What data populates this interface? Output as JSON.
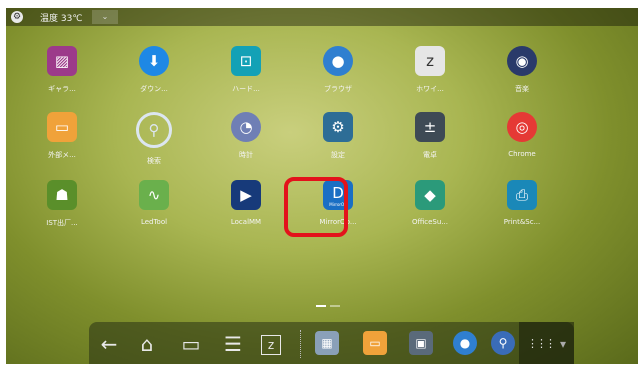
{
  "status_bar": {
    "temperature": "温度 33℃",
    "dropdown": "⌄"
  },
  "apps": [
    {
      "label": "ギャラ...",
      "icon": "gallery-icon",
      "color": "#9c3a8a"
    },
    {
      "label": "ダウン...",
      "icon": "download-icon",
      "color": "#1e88e5"
    },
    {
      "label": "ハード...",
      "icon": "hardware-icon",
      "color": "#13a1b6"
    },
    {
      "label": "ブラウザ",
      "icon": "globe-icon",
      "color": "#2f7fd0"
    },
    {
      "label": "ホワイ...",
      "icon": "whiteboard-icon",
      "color": "#e6e6e6"
    },
    {
      "label": "音楽",
      "icon": "speaker-icon",
      "color": "#2a3a6a"
    },
    {
      "label": "外部メ...",
      "icon": "folder-icon",
      "color": "#f0a23a"
    },
    {
      "label": "検索",
      "icon": "search-icon",
      "color": "#2a5ca8"
    },
    {
      "label": "時計",
      "icon": "clock-icon",
      "color": "#6f7fb5"
    },
    {
      "label": "設定",
      "icon": "gear-icon",
      "color": "#2d6d96"
    },
    {
      "label": "電卓",
      "icon": "calculator-icon",
      "color": "#3e4a55"
    },
    {
      "label": "Chrome",
      "icon": "chrome-icon",
      "color": "#e53935"
    },
    {
      "label": "IST出厂...",
      "icon": "android-icon",
      "color": "#5a8f2a"
    },
    {
      "label": "LedTool",
      "icon": "waveform-icon",
      "color": "#6ab04c"
    },
    {
      "label": "LocalMM",
      "icon": "media-player-icon",
      "color": "#173a7a"
    },
    {
      "label": "MirrorOp...",
      "icon": "mirrorop-icon",
      "color": "#1a6fc4"
    },
    {
      "label": "OfficeSu...",
      "icon": "office-suite-icon",
      "color": "#2b9a7a"
    },
    {
      "label": "Print&Sc...",
      "icon": "print-scan-icon",
      "color": "#1a88b8"
    }
  ],
  "app_glyphs": [
    "▨",
    "⬇",
    "⊡",
    "●",
    "z",
    "◉",
    "▭",
    "⚲",
    "◔",
    "⚙",
    "±",
    "◎",
    "☗",
    "∿",
    "▶",
    "D",
    "◆",
    "⎙"
  ],
  "mirrorop_badge": "MirrorOp",
  "dock": {
    "back": "←",
    "home": "⌂",
    "recents": "▭",
    "menu": "☰",
    "whiteboard": "z",
    "apps_grid": "⋮⋮⋮",
    "more": "▾",
    "apps": [
      {
        "icon": "printer-icon",
        "color": "#8aa0b8",
        "glyph": "▦"
      },
      {
        "icon": "folder-icon",
        "color": "#f0a23a",
        "glyph": "▭"
      },
      {
        "icon": "display-icon",
        "color": "#5a6a7a",
        "glyph": "▣"
      },
      {
        "icon": "globe-icon",
        "color": "#2f7fd0",
        "glyph": "●"
      },
      {
        "icon": "search-icon",
        "color": "#3a6cb8",
        "glyph": "⚲"
      }
    ]
  }
}
